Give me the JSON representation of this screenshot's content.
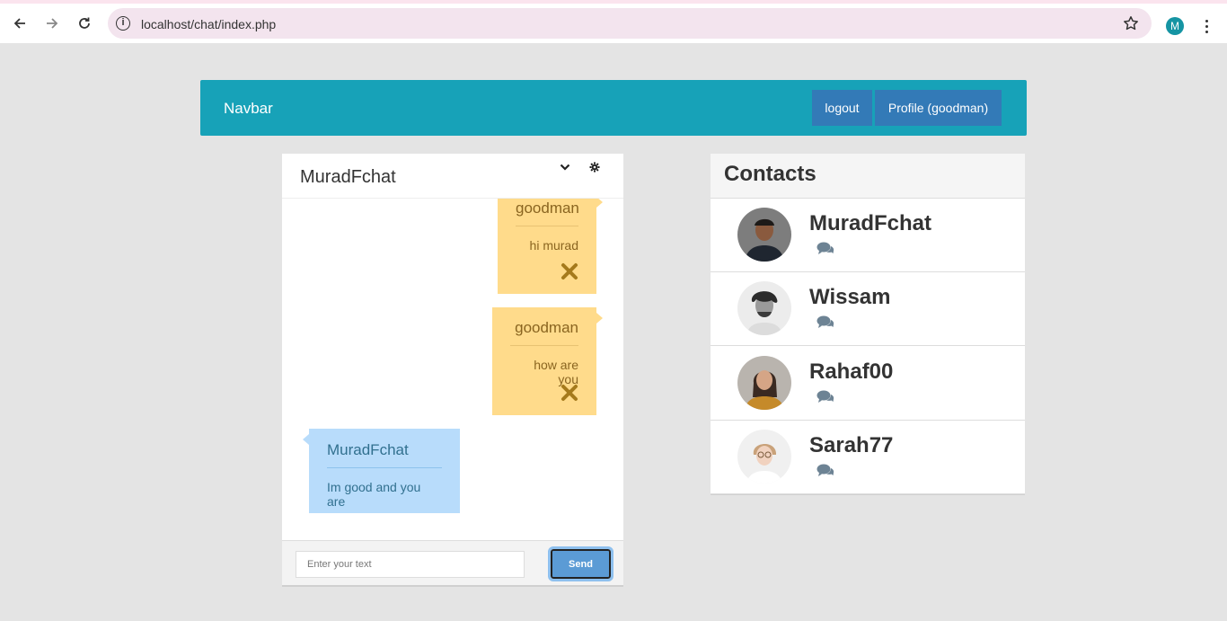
{
  "browser": {
    "url": "localhost/chat/index.php",
    "profile_initial": "M"
  },
  "navbar": {
    "brand": "Navbar",
    "logout_label": "logout",
    "profile_label": "Profile (goodman)"
  },
  "chat": {
    "title": "MuradFchat",
    "messages": [
      {
        "from": "goodman",
        "text": "hi murad",
        "mine": true
      },
      {
        "from": "goodman",
        "text": "how are you",
        "mine": true
      },
      {
        "from": "MuradFchat",
        "text": "Im good and you are",
        "mine": false
      }
    ],
    "input_placeholder": "Enter your text",
    "send_label": "Send"
  },
  "contacts": {
    "title": "Contacts",
    "items": [
      {
        "name": "MuradFchat"
      },
      {
        "name": "Wissam"
      },
      {
        "name": "Rahaf00"
      },
      {
        "name": "Sarah77"
      }
    ]
  },
  "colors": {
    "navbar": "#17a2b8",
    "nav_button": "#337ab7",
    "my_message": "#ffdb8b",
    "their_message": "#b8dcfb"
  }
}
